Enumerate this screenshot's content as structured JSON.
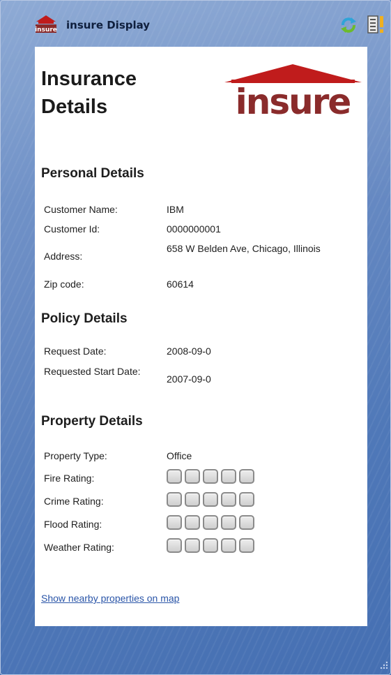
{
  "app": {
    "title": "insure Display",
    "logo_icon": "house-logo-icon",
    "refresh_icon": "refresh-icon",
    "menu_icon": "options-menu-icon"
  },
  "panel": {
    "heading_line1": "Insurance",
    "heading_line2": "Details",
    "brand_text": "insure",
    "brand_color": "#8a2b2b",
    "roof_color": "#c01c1c"
  },
  "personal": {
    "title": "Personal Details",
    "rows": [
      {
        "label": "Customer Name:",
        "value": "IBM"
      },
      {
        "label": "Customer Id:",
        "value": "0000000001"
      },
      {
        "label": "Address:",
        "value": "658 W Belden Ave, Chicago, Illinois"
      },
      {
        "label": "Zip code:",
        "value": "60614"
      }
    ]
  },
  "policy": {
    "title": "Policy Details",
    "rows": [
      {
        "label": "Request Date:",
        "value": "2008-09-0"
      },
      {
        "label": "Requested Start Date:",
        "value": "2007-09-0"
      }
    ]
  },
  "property": {
    "title": "Property Details",
    "type_label": "Property Type:",
    "type_value": "Office",
    "ratings": [
      {
        "label": "Fire Rating:",
        "filled": 0,
        "max": 5
      },
      {
        "label": "Crime Rating:",
        "filled": 0,
        "max": 5
      },
      {
        "label": "Flood Rating:",
        "filled": 0,
        "max": 5
      },
      {
        "label": "Weather Rating:",
        "filled": 0,
        "max": 5
      }
    ]
  },
  "map_link": "Show nearby properties on map"
}
